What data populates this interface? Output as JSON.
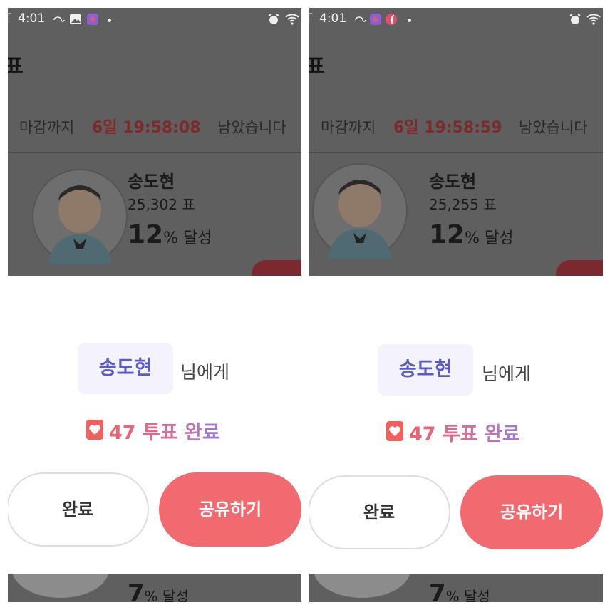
{
  "panels": [
    {
      "status": {
        "lead": "T",
        "time": "4:01"
      },
      "title_glyph": "표",
      "deadline": {
        "prefix": "마감까지",
        "remaining": "6일 19:58:08",
        "suffix": "남았습니다"
      },
      "candidate": {
        "name": "송도현",
        "votes": "25,302 표",
        "percent": "12",
        "percent_unit": "% 달성"
      },
      "dialog": {
        "recipient": "송도현",
        "recipient_suffix": "님에게",
        "vote_result": "47 투표 완료"
      },
      "buttons": {
        "done": "완료",
        "share": "공유하기"
      },
      "next_candidate": {
        "percent": "7",
        "percent_unit": "% 달성"
      }
    },
    {
      "status": {
        "lead": "T",
        "time": "4:01"
      },
      "title_glyph": "표",
      "deadline": {
        "prefix": "마감까지",
        "remaining": "6일 19:58:59",
        "suffix": "남았습니다"
      },
      "candidate": {
        "name": "송도현",
        "votes": "25,255 표",
        "percent": "12",
        "percent_unit": "% 달성"
      },
      "dialog": {
        "recipient": "송도현",
        "recipient_suffix": "님에게",
        "vote_result": "47 투표 완료"
      },
      "buttons": {
        "done": "완료",
        "share": "공유하기"
      },
      "next_candidate": {
        "percent": "7",
        "percent_unit": "% 달성"
      }
    }
  ],
  "colors": {
    "accent_share": "#f16a70",
    "name_chip_text": "#5b5cc3",
    "deadline_time": "#e04a4a",
    "heart": "#f0605e"
  },
  "icons": {
    "status_left": [
      "sync-icon",
      "image-icon",
      "app-icon"
    ],
    "status_right": [
      "alarm-icon",
      "wifi-icon"
    ]
  }
}
